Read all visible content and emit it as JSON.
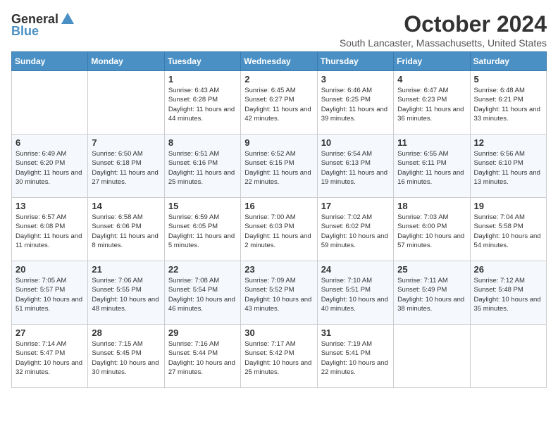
{
  "header": {
    "logo_general": "General",
    "logo_blue": "Blue",
    "month": "October 2024",
    "location": "South Lancaster, Massachusetts, United States"
  },
  "days_of_week": [
    "Sunday",
    "Monday",
    "Tuesday",
    "Wednesday",
    "Thursday",
    "Friday",
    "Saturday"
  ],
  "weeks": [
    [
      {
        "day": "",
        "content": ""
      },
      {
        "day": "",
        "content": ""
      },
      {
        "day": "1",
        "content": "Sunrise: 6:43 AM\nSunset: 6:28 PM\nDaylight: 11 hours and 44 minutes."
      },
      {
        "day": "2",
        "content": "Sunrise: 6:45 AM\nSunset: 6:27 PM\nDaylight: 11 hours and 42 minutes."
      },
      {
        "day": "3",
        "content": "Sunrise: 6:46 AM\nSunset: 6:25 PM\nDaylight: 11 hours and 39 minutes."
      },
      {
        "day": "4",
        "content": "Sunrise: 6:47 AM\nSunset: 6:23 PM\nDaylight: 11 hours and 36 minutes."
      },
      {
        "day": "5",
        "content": "Sunrise: 6:48 AM\nSunset: 6:21 PM\nDaylight: 11 hours and 33 minutes."
      }
    ],
    [
      {
        "day": "6",
        "content": "Sunrise: 6:49 AM\nSunset: 6:20 PM\nDaylight: 11 hours and 30 minutes."
      },
      {
        "day": "7",
        "content": "Sunrise: 6:50 AM\nSunset: 6:18 PM\nDaylight: 11 hours and 27 minutes."
      },
      {
        "day": "8",
        "content": "Sunrise: 6:51 AM\nSunset: 6:16 PM\nDaylight: 11 hours and 25 minutes."
      },
      {
        "day": "9",
        "content": "Sunrise: 6:52 AM\nSunset: 6:15 PM\nDaylight: 11 hours and 22 minutes."
      },
      {
        "day": "10",
        "content": "Sunrise: 6:54 AM\nSunset: 6:13 PM\nDaylight: 11 hours and 19 minutes."
      },
      {
        "day": "11",
        "content": "Sunrise: 6:55 AM\nSunset: 6:11 PM\nDaylight: 11 hours and 16 minutes."
      },
      {
        "day": "12",
        "content": "Sunrise: 6:56 AM\nSunset: 6:10 PM\nDaylight: 11 hours and 13 minutes."
      }
    ],
    [
      {
        "day": "13",
        "content": "Sunrise: 6:57 AM\nSunset: 6:08 PM\nDaylight: 11 hours and 11 minutes."
      },
      {
        "day": "14",
        "content": "Sunrise: 6:58 AM\nSunset: 6:06 PM\nDaylight: 11 hours and 8 minutes."
      },
      {
        "day": "15",
        "content": "Sunrise: 6:59 AM\nSunset: 6:05 PM\nDaylight: 11 hours and 5 minutes."
      },
      {
        "day": "16",
        "content": "Sunrise: 7:00 AM\nSunset: 6:03 PM\nDaylight: 11 hours and 2 minutes."
      },
      {
        "day": "17",
        "content": "Sunrise: 7:02 AM\nSunset: 6:02 PM\nDaylight: 10 hours and 59 minutes."
      },
      {
        "day": "18",
        "content": "Sunrise: 7:03 AM\nSunset: 6:00 PM\nDaylight: 10 hours and 57 minutes."
      },
      {
        "day": "19",
        "content": "Sunrise: 7:04 AM\nSunset: 5:58 PM\nDaylight: 10 hours and 54 minutes."
      }
    ],
    [
      {
        "day": "20",
        "content": "Sunrise: 7:05 AM\nSunset: 5:57 PM\nDaylight: 10 hours and 51 minutes."
      },
      {
        "day": "21",
        "content": "Sunrise: 7:06 AM\nSunset: 5:55 PM\nDaylight: 10 hours and 48 minutes."
      },
      {
        "day": "22",
        "content": "Sunrise: 7:08 AM\nSunset: 5:54 PM\nDaylight: 10 hours and 46 minutes."
      },
      {
        "day": "23",
        "content": "Sunrise: 7:09 AM\nSunset: 5:52 PM\nDaylight: 10 hours and 43 minutes."
      },
      {
        "day": "24",
        "content": "Sunrise: 7:10 AM\nSunset: 5:51 PM\nDaylight: 10 hours and 40 minutes."
      },
      {
        "day": "25",
        "content": "Sunrise: 7:11 AM\nSunset: 5:49 PM\nDaylight: 10 hours and 38 minutes."
      },
      {
        "day": "26",
        "content": "Sunrise: 7:12 AM\nSunset: 5:48 PM\nDaylight: 10 hours and 35 minutes."
      }
    ],
    [
      {
        "day": "27",
        "content": "Sunrise: 7:14 AM\nSunset: 5:47 PM\nDaylight: 10 hours and 32 minutes."
      },
      {
        "day": "28",
        "content": "Sunrise: 7:15 AM\nSunset: 5:45 PM\nDaylight: 10 hours and 30 minutes."
      },
      {
        "day": "29",
        "content": "Sunrise: 7:16 AM\nSunset: 5:44 PM\nDaylight: 10 hours and 27 minutes."
      },
      {
        "day": "30",
        "content": "Sunrise: 7:17 AM\nSunset: 5:42 PM\nDaylight: 10 hours and 25 minutes."
      },
      {
        "day": "31",
        "content": "Sunrise: 7:19 AM\nSunset: 5:41 PM\nDaylight: 10 hours and 22 minutes."
      },
      {
        "day": "",
        "content": ""
      },
      {
        "day": "",
        "content": ""
      }
    ]
  ]
}
